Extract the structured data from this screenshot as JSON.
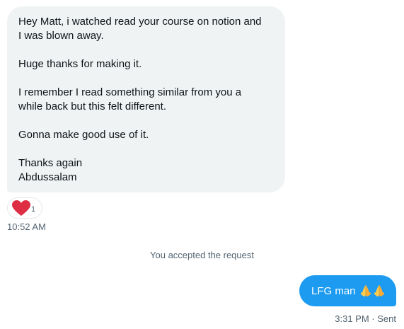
{
  "incoming_message": {
    "paragraphs": [
      [
        "Hey Matt, i watched read your course on notion and",
        "I was blown away."
      ],
      [
        "Huge thanks for making it."
      ],
      [
        "I remember I read something similar from you a",
        "while back but this felt different."
      ],
      [
        "Gonna make good use of it."
      ],
      [
        "Thanks again",
        "Abdussalam"
      ]
    ],
    "reaction": {
      "emoji": "heart-icon",
      "count": "1",
      "color": "#e0245e"
    },
    "time": "10:52 AM",
    "bubble_color": "#eff3f4"
  },
  "system_note": "You accepted the request",
  "outgoing_message": {
    "text": "LFG man",
    "emojis": [
      "folded-hands-icon",
      "folded-hands-icon"
    ],
    "time": "3:31 PM",
    "status": "Sent",
    "bubble_color": "#1d9bf0"
  }
}
